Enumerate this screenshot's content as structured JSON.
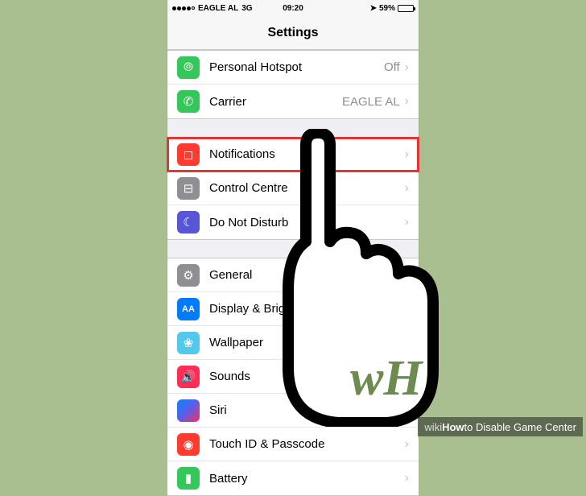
{
  "status_bar": {
    "carrier": "EAGLE AL",
    "network": "3G",
    "time": "09:20",
    "location_glyph": "➤",
    "battery_pct": "59%"
  },
  "nav": {
    "title": "Settings"
  },
  "groups": [
    {
      "rows": [
        {
          "id": "personal-hotspot",
          "label": "Personal Hotspot",
          "value": "Off",
          "icon": "hotspot",
          "glyph": "⦾"
        },
        {
          "id": "carrier",
          "label": "Carrier",
          "value": "EAGLE AL",
          "icon": "carrier",
          "glyph": "✆"
        }
      ]
    },
    {
      "rows": [
        {
          "id": "notifications",
          "label": "Notifications",
          "icon": "notif",
          "glyph": "◻",
          "highlight": true
        },
        {
          "id": "control-centre",
          "label": "Control Centre",
          "icon": "control",
          "glyph": "⊟"
        },
        {
          "id": "do-not-disturb",
          "label": "Do Not Disturb",
          "icon": "dnd",
          "glyph": "☾"
        }
      ]
    },
    {
      "rows": [
        {
          "id": "general",
          "label": "General",
          "icon": "general",
          "glyph": "⚙"
        },
        {
          "id": "display-brightness",
          "label": "Display & Brightness",
          "icon": "display",
          "glyph": "AA"
        },
        {
          "id": "wallpaper",
          "label": "Wallpaper",
          "icon": "wallpaper",
          "glyph": "❀"
        },
        {
          "id": "sounds",
          "label": "Sounds",
          "icon": "sounds",
          "glyph": "🔊"
        },
        {
          "id": "siri",
          "label": "Siri",
          "icon": "siri",
          "glyph": ""
        },
        {
          "id": "touch-id-passcode",
          "label": "Touch ID & Passcode",
          "icon": "touchid",
          "glyph": "◉"
        },
        {
          "id": "battery",
          "label": "Battery",
          "icon": "battery",
          "glyph": "▮"
        }
      ]
    }
  ],
  "hand_logo": "wH",
  "caption": {
    "brand_prefix": "wiki",
    "brand_bold": "How",
    "text": " to Disable Game Center"
  }
}
